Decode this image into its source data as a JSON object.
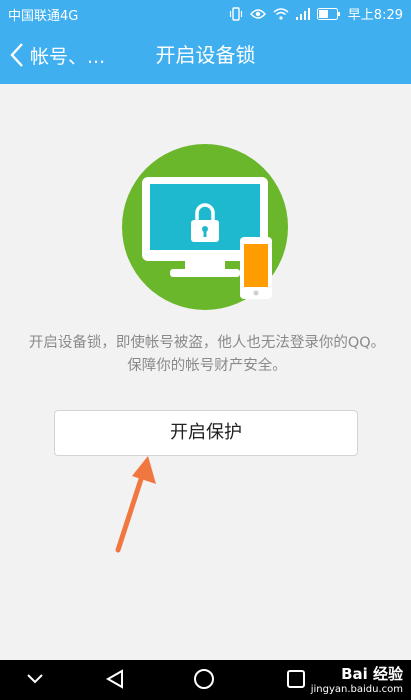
{
  "status_bar": {
    "carrier": "中国联通4G",
    "time": "早上8:29",
    "icons": [
      "vibrate-icon",
      "eye-icon",
      "wifi-icon",
      "signal-icon",
      "battery-icon"
    ]
  },
  "header": {
    "back_label": "帐号、...",
    "title": "开启设备锁"
  },
  "main": {
    "description": "开启设备锁，即使帐号被盗，他人也无法登录你的QQ。保障你的帐号财产安全。",
    "protect_button": "开启保护"
  },
  "nav_bar": {
    "buttons": [
      "hide-keyboard-icon",
      "back-triangle-icon",
      "home-circle-icon",
      "recents-square-icon"
    ]
  },
  "watermark": {
    "brand": "Bai 经验",
    "url": "jingyan.baidu.com"
  },
  "colors": {
    "accent": "#3faff0",
    "circle_green": "#6ab72b",
    "screen_cyan": "#1fb9cf",
    "phone_orange": "#ff9c00",
    "arrow": "#f07840"
  }
}
